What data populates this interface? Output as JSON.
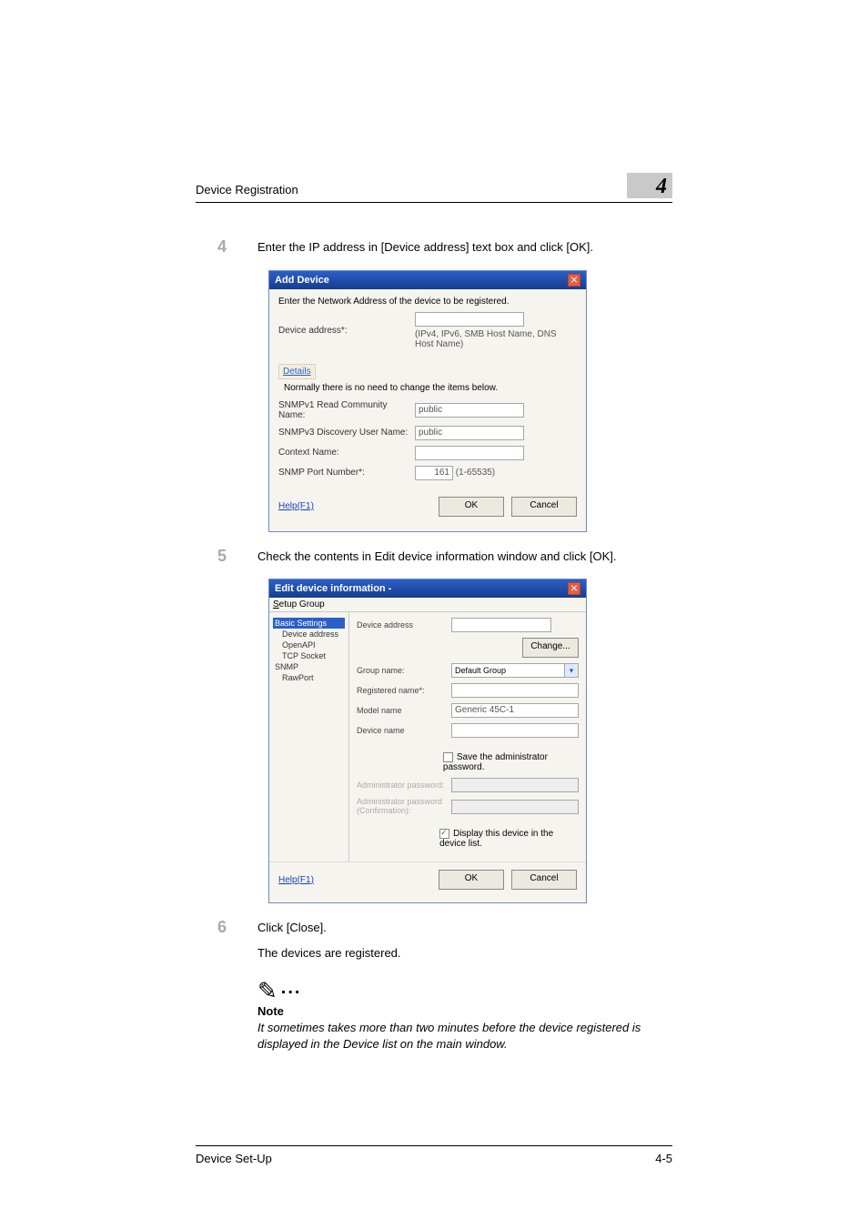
{
  "header": {
    "section_title": "Device Registration",
    "badge_num": "4"
  },
  "steps": {
    "s4": {
      "num": "4",
      "text": "Enter the IP address in [Device address] text box and click [OK]."
    },
    "s5": {
      "num": "5",
      "text": "Check the contents in Edit device information window and click [OK]."
    },
    "s6": {
      "num": "6",
      "text": "Click [Close].",
      "body": "The devices are registered."
    }
  },
  "dlg1": {
    "title": "Add Device",
    "instruction": "Enter the Network Address of the device to be registered.",
    "addr_label": "Device address*:",
    "addr_hint": "(IPv4, IPv6, SMB Host Name, DNS Host Name)",
    "details_label": "Details",
    "details_note": "Normally there is no need to change the items below.",
    "snmpv1_label": "SNMPv1 Read Community Name:",
    "snmpv1_val": "public",
    "snmpv3_label": "SNMPv3 Discovery User Name:",
    "snmpv3_val": "public",
    "context_label": "Context Name:",
    "port_label": "SNMP Port Number*:",
    "port_val": "161",
    "port_range": "(1-65535)",
    "help": "Help(F1)",
    "ok": "OK",
    "cancel": "Cancel"
  },
  "dlg2": {
    "title_prefix": "Edit device information - ",
    "menu_setup": "Setup Group",
    "nav": {
      "basic": "Basic Settings",
      "devaddr": "Device address",
      "openapi": "OpenAPI",
      "tcp": "TCP Socket",
      "snmp": "SNMP",
      "raw": "RawPort"
    },
    "fields": {
      "devaddr": "Device address",
      "change": "Change...",
      "group": "Group name:",
      "group_val": "Default Group",
      "regname": "Registered name*:",
      "model": "Model name",
      "model_val": "Generic 45C-1",
      "devname": "Device name",
      "savepw": "Save the administrator password.",
      "adminpw": "Administrator password:",
      "adminpw2": "Administrator password (Confirmation):",
      "display": "Display this device in the device list."
    },
    "help": "Help(F1)",
    "ok": "OK",
    "cancel": "Cancel"
  },
  "note": {
    "title": "Note",
    "body": "It sometimes takes more than two minutes before the device registered is displayed in the Device list on the main window."
  },
  "footer": {
    "left": "Device Set-Up",
    "right": "4-5"
  }
}
